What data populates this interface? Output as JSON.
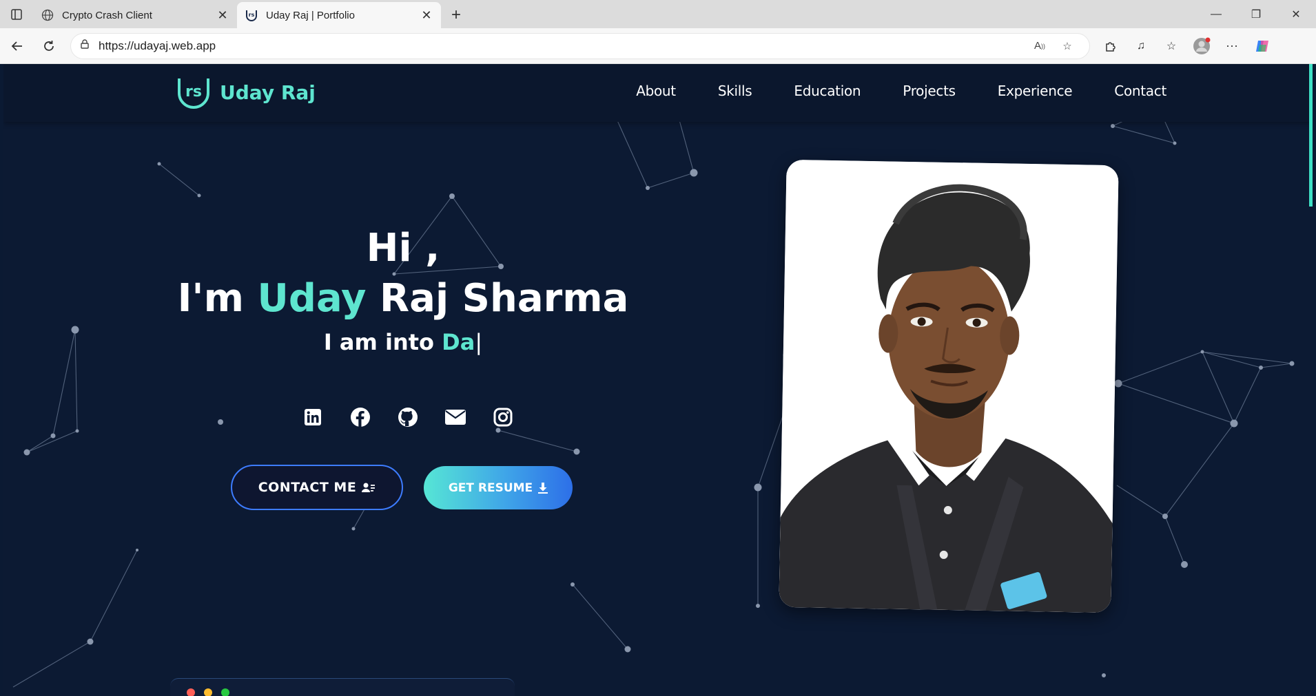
{
  "browser": {
    "tabs": [
      {
        "title": "Crypto Crash Client",
        "icon": "globe-icon",
        "active": false
      },
      {
        "title": "Uday Raj | Portfolio",
        "icon": "site-logo-icon",
        "active": true
      }
    ],
    "url": "https://udayaj.web.app",
    "window_controls": [
      "minimize-icon",
      "restore-icon",
      "close-icon"
    ]
  },
  "site": {
    "brand": "Uday Raj",
    "logo_text": "rs",
    "nav": [
      "About",
      "Skills",
      "Education",
      "Projects",
      "Experience",
      "Contact"
    ]
  },
  "hero": {
    "greeting": "Hi ,",
    "name_prefix": "I'm ",
    "name_accent": "Uday",
    "name_rest": " Raj Sharma",
    "typing_prefix": "I am into ",
    "typing_text": "Da",
    "cursor": "|",
    "socials": [
      "linkedin-icon",
      "facebook-icon",
      "github-icon",
      "email-icon",
      "instagram-icon"
    ],
    "contact_button": "CONTACT ME",
    "resume_button": "GET RESUME"
  },
  "colors": {
    "accent": "#5ee5cf",
    "page_bg": "#0c1a33",
    "button_border": "#3d7cff"
  },
  "terminal_dots": [
    "#ff5f57",
    "#febc2e",
    "#28c840"
  ]
}
